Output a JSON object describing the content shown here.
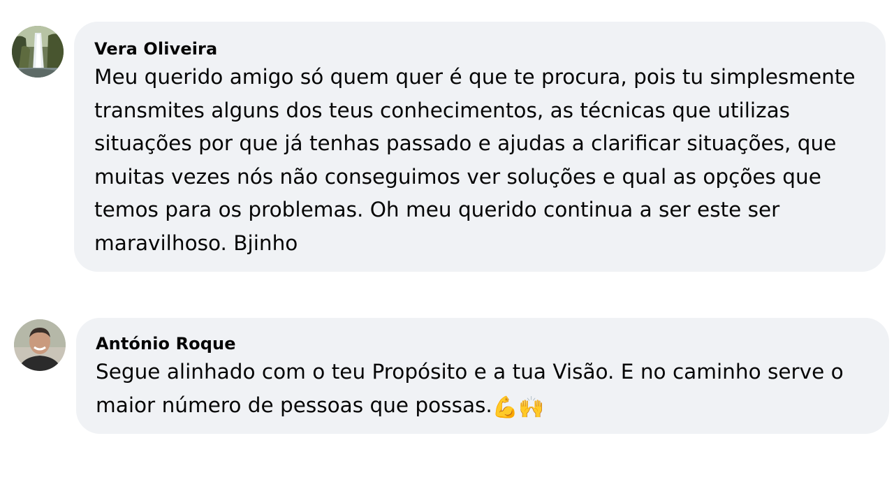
{
  "comments": [
    {
      "author": "Vera Oliveira",
      "avatar_icon": "waterfall-photo-avatar",
      "text": "Meu querido amigo só quem quer é que te procura, pois tu simplesmente transmites alguns dos teus conhecimentos, as técnicas que utilizas situações por que já tenhas passado e ajudas a clarificar situações, que muitas vezes nós não conseguimos ver soluções e qual as opções que temos para os problemas. Oh meu querido continua a ser este ser maravilhoso. Bjinho"
    },
    {
      "author": "António Roque",
      "avatar_icon": "man-photo-avatar",
      "text": "Segue alinhado com o teu Propósito e a tua Visão. E no caminho serve o maior número de pessoas que possas.",
      "emojis": "💪🙌"
    }
  ],
  "colors": {
    "bubble_bg": "#f0f2f5",
    "text": "#050505",
    "page_bg": "#ffffff"
  }
}
